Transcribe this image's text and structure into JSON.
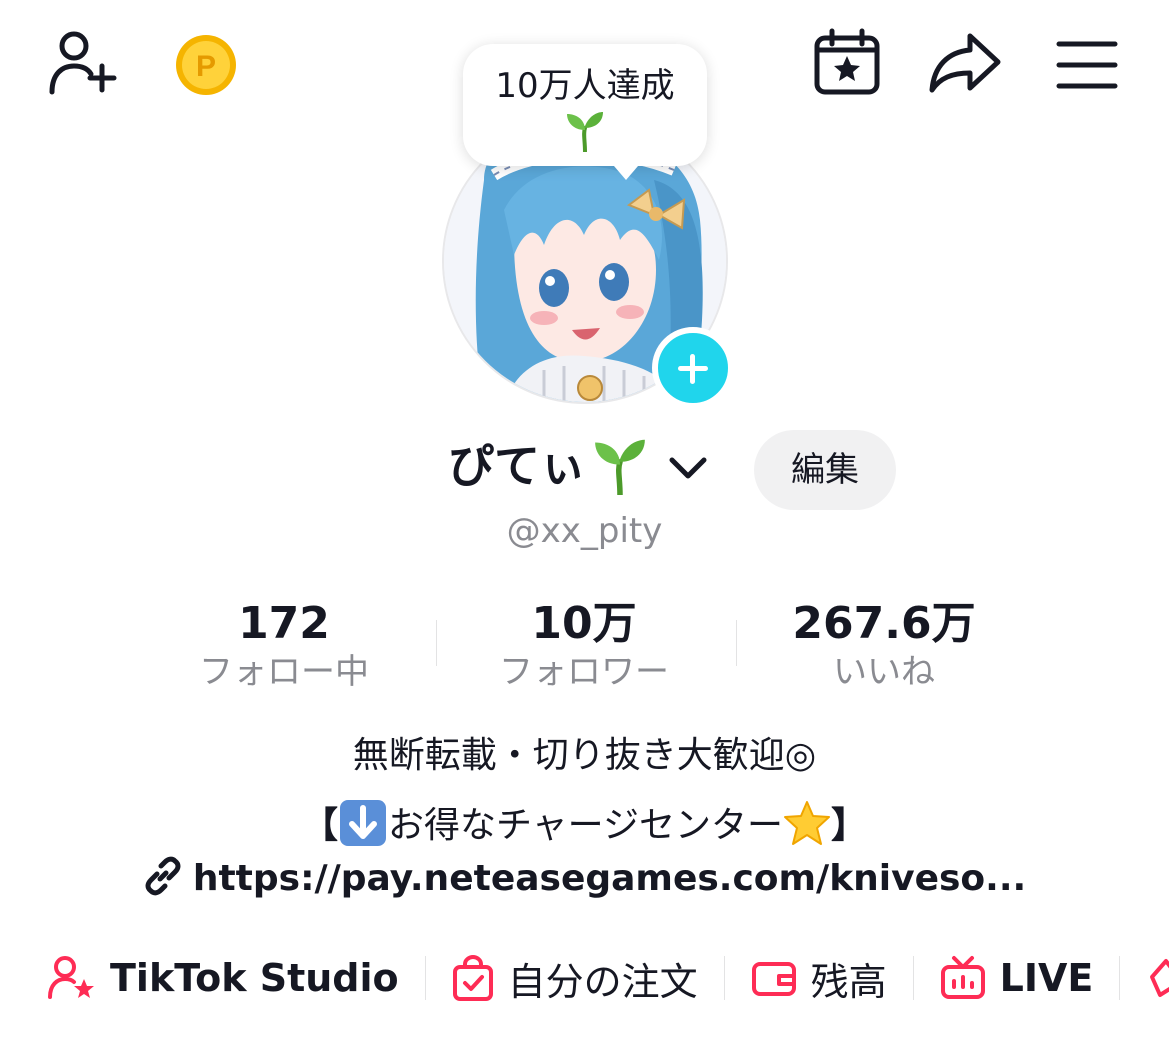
{
  "topbar": {
    "icons": [
      "add-friend-icon",
      "coin-icon",
      "calendar-star-icon",
      "share-icon",
      "menu-icon"
    ],
    "coin_letter": "P"
  },
  "bubble": {
    "text": "10万人達成"
  },
  "profile": {
    "name": "ぴてぃ",
    "edit_label": "編集",
    "handle": "@xx_pity"
  },
  "stats": [
    {
      "value": "172",
      "label": "フォロー中"
    },
    {
      "value": "10万",
      "label": "フォロワー"
    },
    {
      "value": "267.6万",
      "label": "いいね"
    }
  ],
  "bio": {
    "line1": "無断転載・切り抜き大歓迎◎",
    "line2_open": "【",
    "line2_text": "お得なチャージセンター",
    "line2_close": "】",
    "link": "https://pay.neteasegames.com/kniveso..."
  },
  "tools": [
    {
      "label": "TikTok Studio",
      "icon": "studio-icon"
    },
    {
      "label": "自分の注文",
      "icon": "orders-icon"
    },
    {
      "label": "残高",
      "icon": "wallet-icon"
    },
    {
      "label": "LIVE",
      "icon": "live-icon"
    }
  ],
  "colors": {
    "accent_cyan": "#20d5ec",
    "tool_red": "#fe2c55",
    "text": "#161823",
    "muted": "#8a8b91"
  }
}
